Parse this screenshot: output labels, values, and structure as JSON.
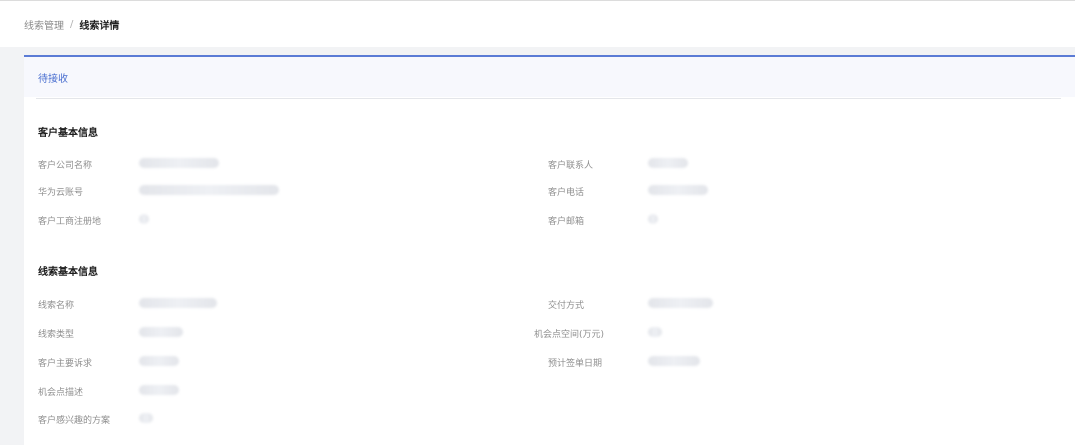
{
  "breadcrumb": {
    "parent": "线索管理",
    "separator": "/",
    "current": "线索详情"
  },
  "status": "待接收",
  "sections": {
    "customer": {
      "title": "客户基本信息",
      "labels": {
        "company_name": "客户公司名称",
        "contact": "客户联系人",
        "cloud_account": "华为云账号",
        "phone": "客户电话",
        "registration_place": "客户工商注册地",
        "email": "客户邮箱"
      }
    },
    "lead": {
      "title": "线索基本信息",
      "labels": {
        "lead_name": "线索名称",
        "delivery_method": "交付方式",
        "lead_type": "线索类型",
        "opportunity_space": "机会点空间(万元)",
        "main_demand": "客户主要诉求",
        "expected_sign_date": "预计签单日期",
        "opportunity_desc": "机会点描述",
        "interested_solution": "客户感兴趣的方案"
      }
    }
  },
  "colors": {
    "accent": "#5b7bd5",
    "status_text": "#4a6fd0",
    "label_text": "#8f8f8f",
    "page_bg": "#f2f3f5"
  }
}
